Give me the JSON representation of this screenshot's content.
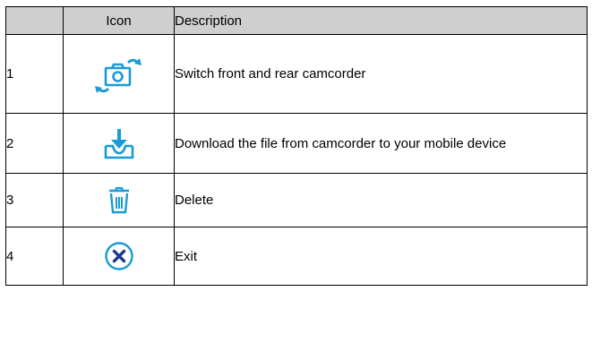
{
  "table": {
    "headers": {
      "number": "",
      "icon": "Icon",
      "description": "Description"
    },
    "rows": [
      {
        "number": "1",
        "icon": "switch-camera-icon",
        "description": "Switch front and rear camcorder"
      },
      {
        "number": "2",
        "icon": "download-tray-icon",
        "description": "Download the file from camcorder to your mobile device"
      },
      {
        "number": "3",
        "icon": "trash-icon",
        "description": "Delete"
      },
      {
        "number": "4",
        "icon": "close-circle-icon",
        "description": "Exit"
      }
    ]
  },
  "colors": {
    "icon_blue": "#1a9ad6",
    "header_bg": "#cfcfcf"
  }
}
